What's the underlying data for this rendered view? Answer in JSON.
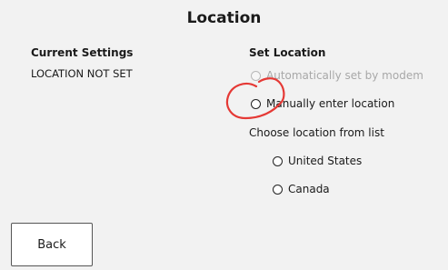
{
  "page": {
    "title": "Location"
  },
  "current": {
    "heading": "Current Settings",
    "value": "LOCATION NOT SET"
  },
  "set": {
    "heading": "Set Location",
    "options": [
      {
        "label": "Automatically set by modem",
        "enabled": false,
        "selected": false
      },
      {
        "label": "Manually enter location",
        "enabled": true,
        "selected": false
      }
    ],
    "list_label": "Choose location from list",
    "countries": [
      {
        "label": "United States",
        "selected": false
      },
      {
        "label": "Canada",
        "selected": false
      }
    ]
  },
  "footer": {
    "back_label": "Back"
  },
  "annotation": {
    "color": "#e53935"
  }
}
